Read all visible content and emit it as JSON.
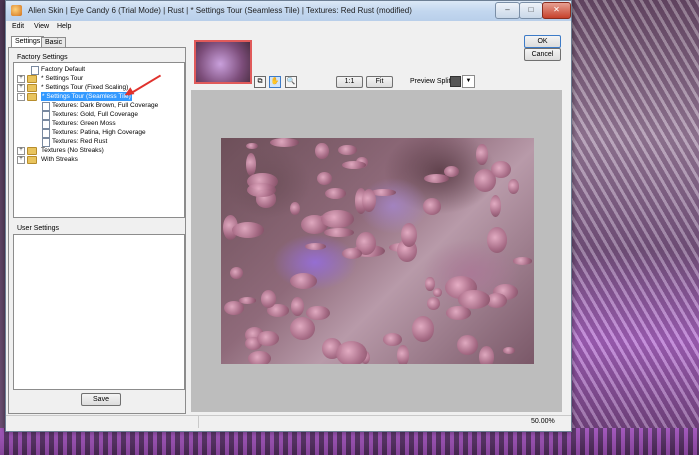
{
  "window": {
    "title": "Alien Skin | Eye Candy 6 (Trial Mode) | Rust | * Settings Tour (Seamless Tile) | Textures: Red Rust (modified)",
    "buttons": {
      "min": "–",
      "max": "□",
      "close": "✕"
    }
  },
  "menu": [
    "Edit",
    "View",
    "Help"
  ],
  "tabs": [
    "Settings",
    "Basic"
  ],
  "factory_settings": {
    "label": "Factory Settings",
    "items": [
      {
        "label": "Factory Default",
        "type": "doc",
        "level": 1
      },
      {
        "label": "* Settings Tour",
        "type": "folder",
        "level": 0,
        "expander": "+"
      },
      {
        "label": "* Settings Tour (Fixed Scaling)",
        "type": "folder",
        "level": 0,
        "expander": "+"
      },
      {
        "label": "* Settings Tour (Seamless Tile)",
        "type": "folder",
        "level": 0,
        "expander": "-",
        "selected": true
      },
      {
        "label": "Textures: Dark Brown, Full Coverage",
        "type": "doc",
        "level": 2
      },
      {
        "label": "Textures: Gold, Full Coverage",
        "type": "doc",
        "level": 2
      },
      {
        "label": "Textures: Green Moss",
        "type": "doc",
        "level": 2
      },
      {
        "label": "Textures: Patina, High Coverage",
        "type": "doc",
        "level": 2
      },
      {
        "label": "Textures: Red Rust",
        "type": "doc",
        "level": 2
      },
      {
        "label": "Textures (No Streaks)",
        "type": "folder",
        "level": 0,
        "expander": "+"
      },
      {
        "label": "With Streaks",
        "type": "folder",
        "level": 0,
        "expander": "+"
      }
    ]
  },
  "user_settings": {
    "label": "User Settings"
  },
  "save_label": "Save",
  "ok_label": "OK",
  "cancel_label": "Cancel",
  "toolbar": {
    "one_to_one": "1:1",
    "fit": "Fit",
    "preview_split_label": "Preview Split:",
    "dropdown_glyph": "▼"
  },
  "status": {
    "zoom": "50.00%"
  },
  "colors": {
    "selection": "#3399ff",
    "annotation_arrow": "#e0322d"
  }
}
